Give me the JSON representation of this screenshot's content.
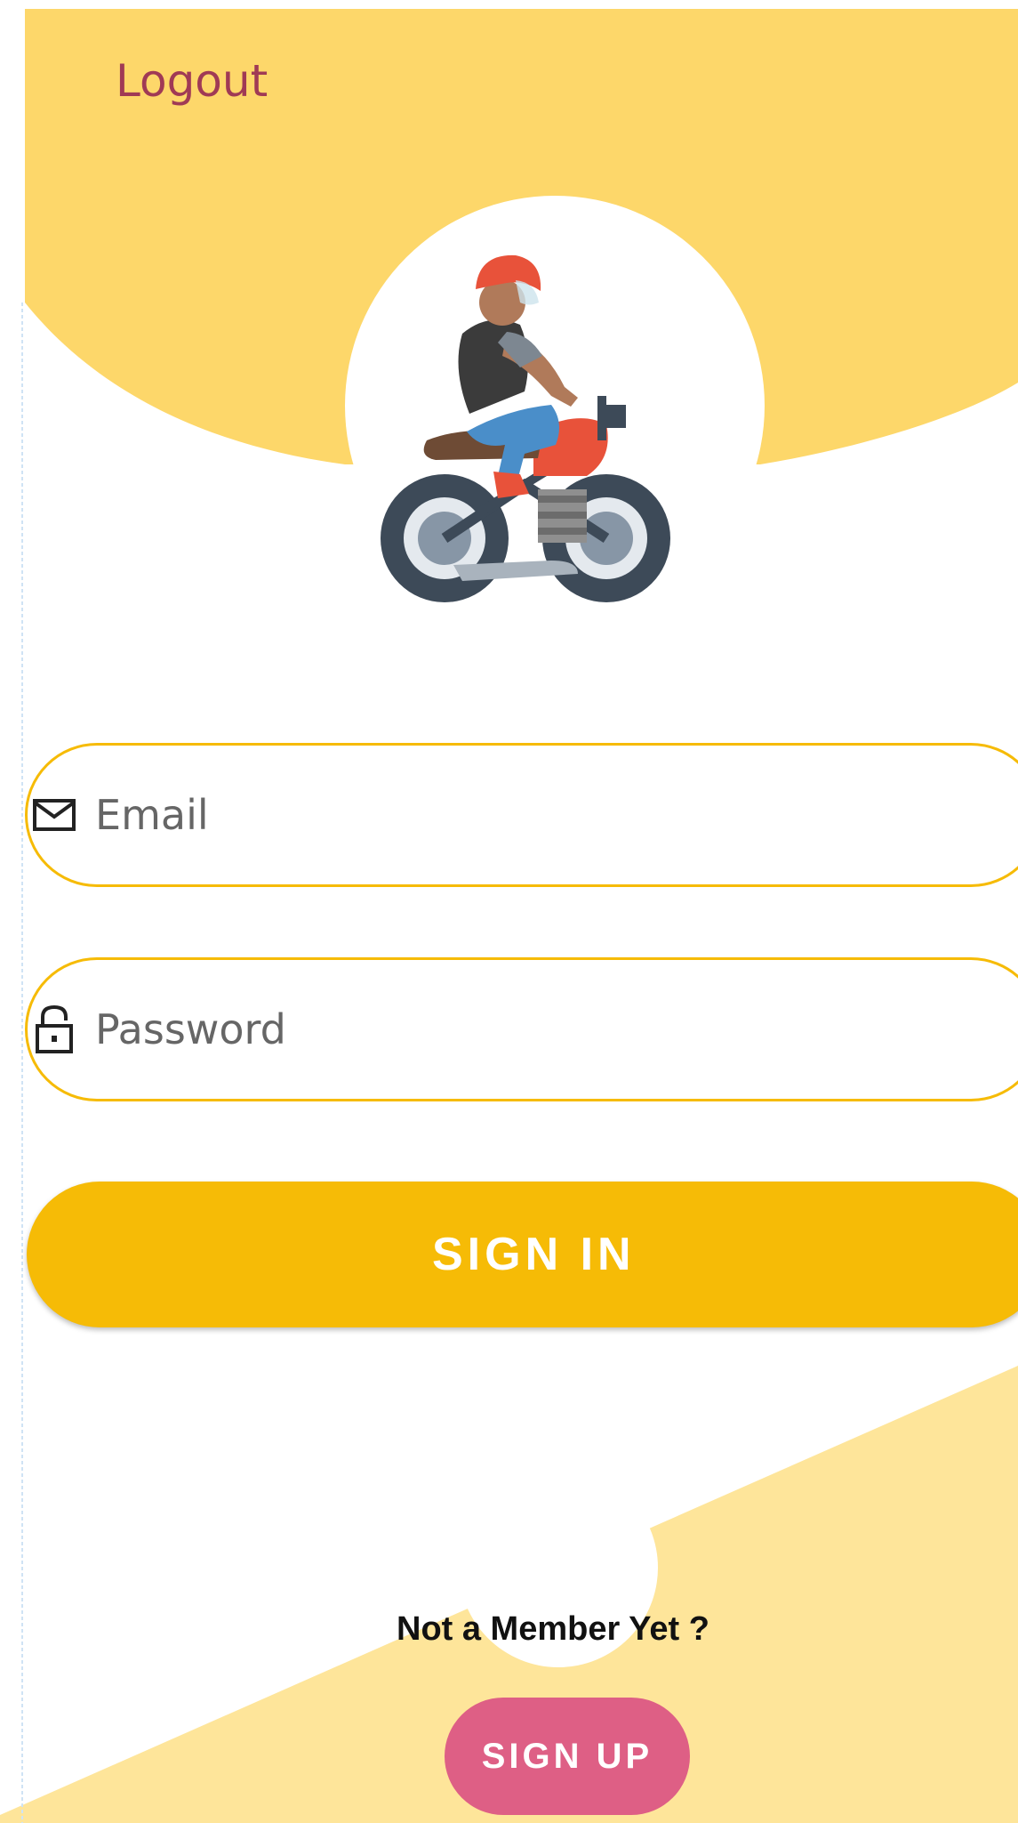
{
  "header": {
    "logout_label": "Logout"
  },
  "form": {
    "email_placeholder": "Email",
    "email_value": "",
    "password_placeholder": "Password",
    "password_value": "",
    "signin_label": "SIGN IN"
  },
  "footer": {
    "prompt": "Not a Member Yet ?",
    "signup_label": "SIGN UP"
  },
  "icons": {
    "email": "envelope-icon",
    "password": "lock-icon",
    "hero": "motorcycle-rider-illustration"
  },
  "colors": {
    "top_blob": "#fdd76a",
    "bottom_blob": "#fee59a",
    "accent": "#f6bb06",
    "signup": "#de5f85",
    "logout_text": "#a03a55"
  }
}
